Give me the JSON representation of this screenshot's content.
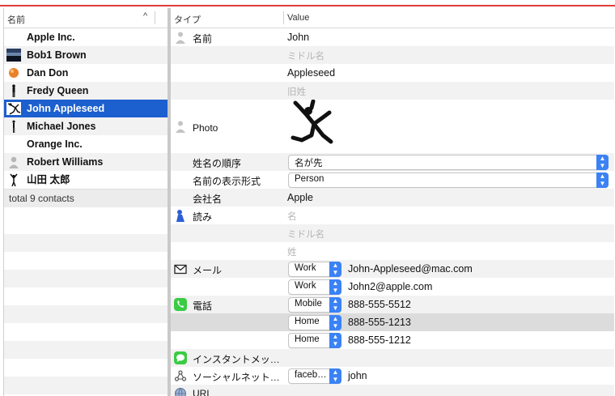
{
  "left": {
    "header_label": "名前",
    "contacts": [
      {
        "name": "Apple Inc.",
        "icon": "none"
      },
      {
        "name": "Bob1 Brown",
        "icon": "landscape-photo-icon"
      },
      {
        "name": "Dan Don",
        "icon": "orange-photo-icon"
      },
      {
        "name": "Fredy Queen",
        "icon": "standing-person-icon"
      },
      {
        "name": "John Appleseed",
        "icon": "jumping-person-icon"
      },
      {
        "name": "Michael Jones",
        "icon": "standing-person-icon"
      },
      {
        "name": "Orange Inc.",
        "icon": "none"
      },
      {
        "name": "Robert Williams",
        "icon": "generic-person-icon"
      },
      {
        "name": "山田 太郎",
        "icon": "arms-up-person-icon"
      }
    ],
    "selected_index": 4,
    "footer": "total 9 contacts"
  },
  "right": {
    "col_type": "タイプ",
    "col_value": "Value",
    "name_label": "名前",
    "first": "John",
    "middle_ph": "ミドル名",
    "last": "Appleseed",
    "maiden_ph": "旧姓",
    "photo_label": "Photo",
    "order_label": "姓名の順序",
    "order_value": "名が先",
    "display_label": "名前の表示形式",
    "display_value": "Person",
    "company_label": "会社名",
    "company_value": "Apple",
    "reading_label": "読み",
    "reading_first_ph": "名",
    "reading_middle_ph": "ミドル名",
    "reading_last_ph": "姓",
    "email_label": "メール",
    "emails": [
      {
        "type": "Work",
        "value": "John-Appleseed@mac.com"
      },
      {
        "type": "Work",
        "value": "John2@apple.com"
      }
    ],
    "phone_label": "電話",
    "phones": [
      {
        "type": "Mobile",
        "value": "888-555-5512"
      },
      {
        "type": "Home",
        "value": "888-555-1213"
      },
      {
        "type": "Home",
        "value": "888-555-1212"
      }
    ],
    "im_label": "インスタントメッ…",
    "social_label": "ソーシャルネット…",
    "social": {
      "type": "faceb…",
      "value": "john"
    },
    "url_label": "URL"
  },
  "colors": {
    "selection": "#1c5fce",
    "popup_arrow": "#3b82f6",
    "top_line": "#e23b3b",
    "placeholder": "#b5b5b5"
  }
}
